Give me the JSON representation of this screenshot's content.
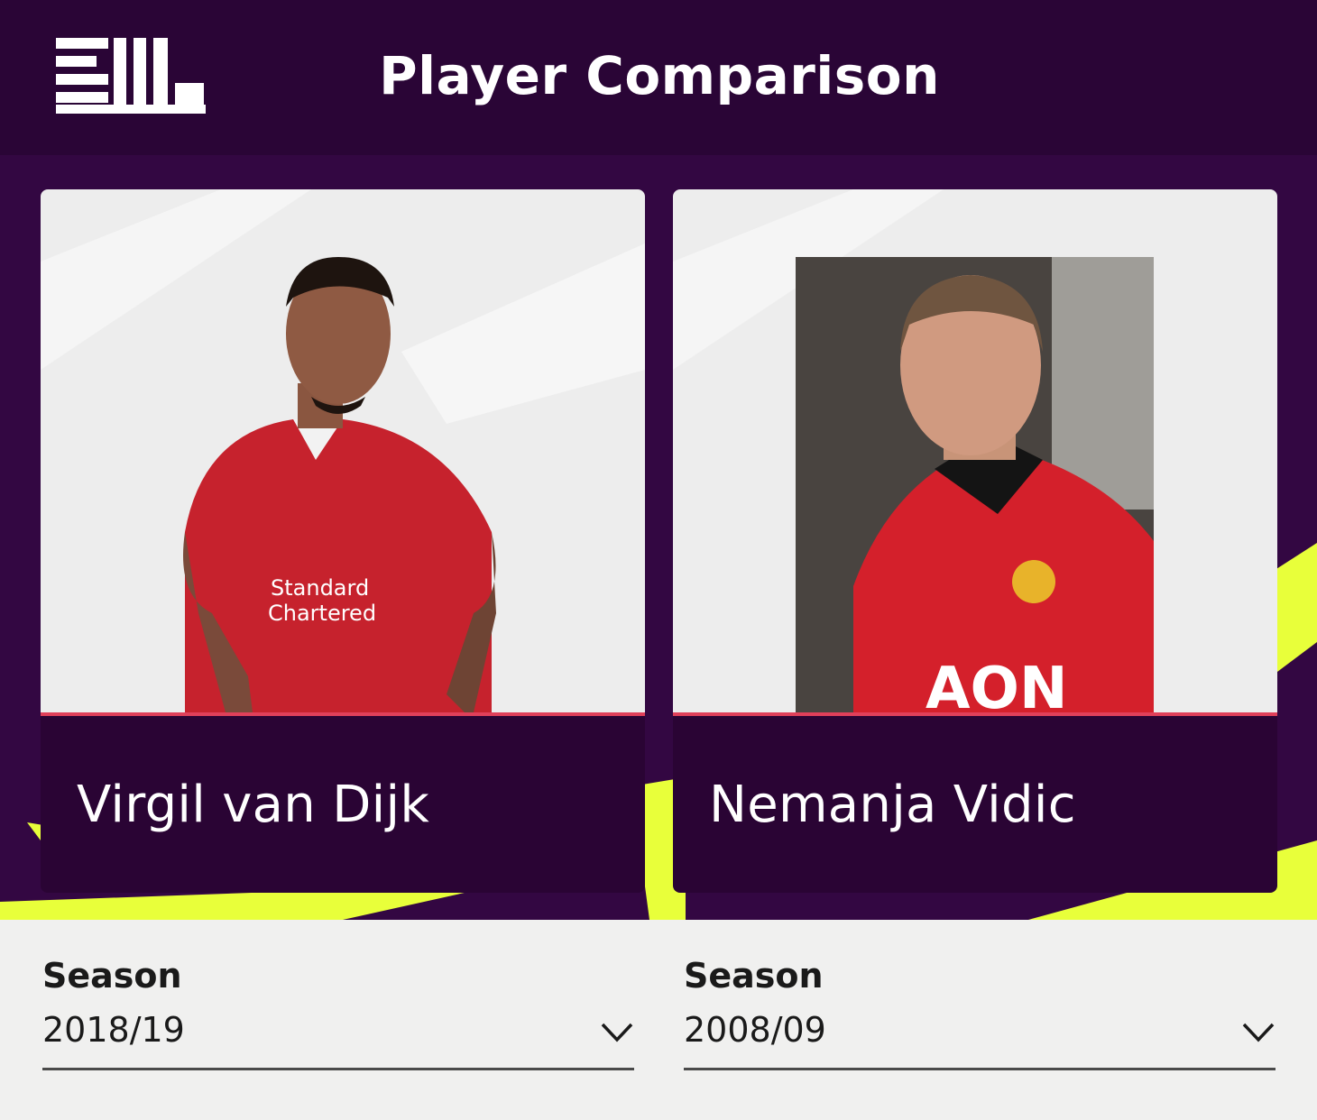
{
  "header": {
    "title": "Player Comparison",
    "logo_icon": "premier-league-logo"
  },
  "players": [
    {
      "name": "Virgil van Dijk",
      "season_label": "Season",
      "season_value": "2018/19"
    },
    {
      "name": "Nemanja Vidic",
      "season_label": "Season",
      "season_value": "2008/09"
    }
  ],
  "colors": {
    "header_bg": "#2a0536",
    "hero_bg": "#330742",
    "accent_yellow": "#e8ff3a",
    "accent_pink": "#e0405a",
    "card_bg": "#2a0434"
  }
}
